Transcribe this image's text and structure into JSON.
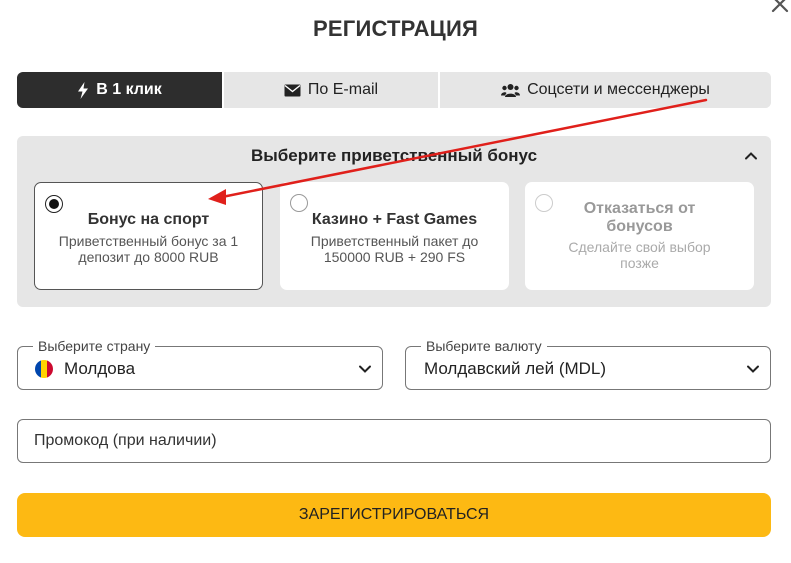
{
  "dialog": {
    "title": "РЕГИСТРАЦИЯ",
    "close_icon": "close-icon"
  },
  "tabs": [
    {
      "label": "В 1 клик",
      "icon": "lightning-icon",
      "active": true
    },
    {
      "label": "По E-mail",
      "icon": "envelope-icon",
      "active": false
    },
    {
      "label": "Соцсети и мессенджеры",
      "icon": "users-icon",
      "active": false
    }
  ],
  "bonus": {
    "header": "Выберите приветственный бонус",
    "toggle_icon": "chevron-up-icon",
    "options": [
      {
        "title": "Бонус на спорт",
        "description": "Приветственный бонус за 1 депозит до 8000 RUB",
        "selected": true
      },
      {
        "title": "Казино + Fast Games",
        "description": "Приветственный пакет до 150000 RUB + 290 FS",
        "selected": false
      },
      {
        "title": "Отказаться от бонусов",
        "description": "Сделайте свой выбор позже",
        "selected": false
      }
    ]
  },
  "country": {
    "label": "Выберите страну",
    "value": "Молдова",
    "flag_icon": "moldova-flag-icon",
    "flag_colors": [
      "#0046ae",
      "#ffd200",
      "#cc092f"
    ]
  },
  "currency": {
    "label": "Выберите валюту",
    "value": "Молдавский лей (MDL)"
  },
  "promo": {
    "placeholder": "Промокод (при наличии)"
  },
  "submit": {
    "label": "ЗАРЕГИСТРИРОВАТЬСЯ",
    "color": "#fdb913"
  },
  "annotation": {
    "arrow_color": "#e0201b"
  }
}
